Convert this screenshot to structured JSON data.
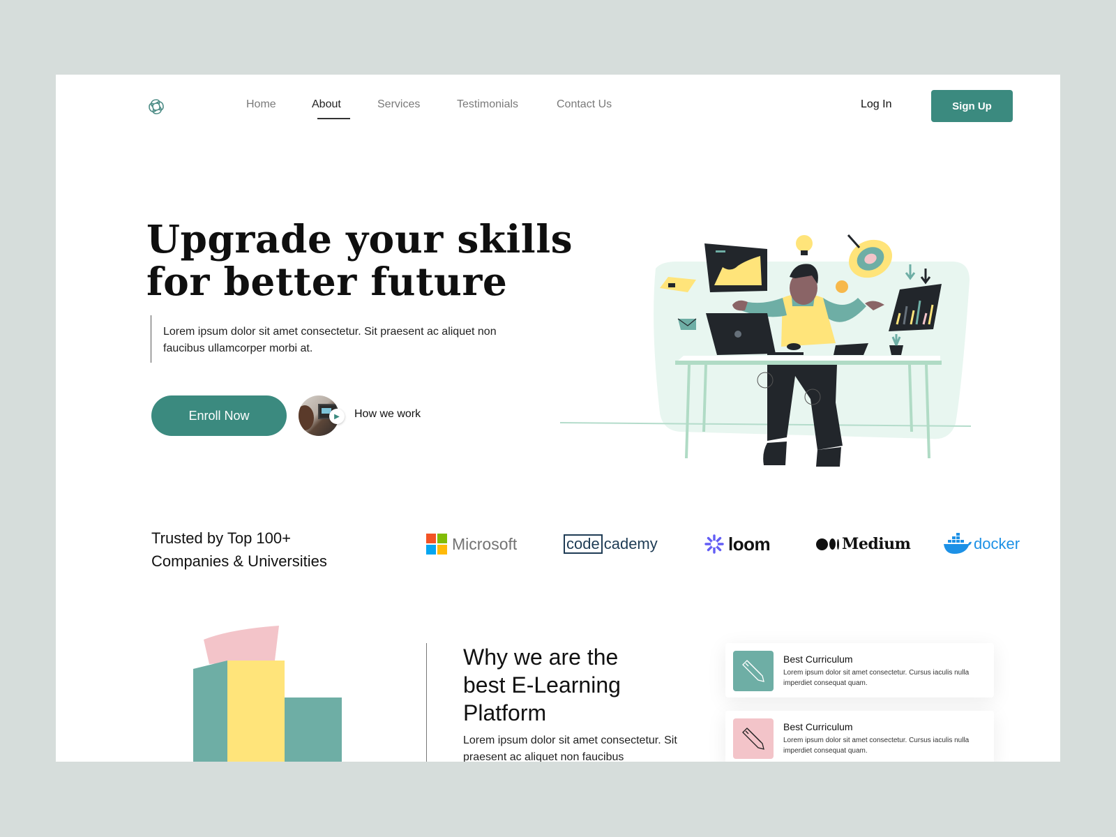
{
  "nav": {
    "logo_icon": "swirl-logo-icon",
    "items": [
      {
        "label": "Home",
        "active": false
      },
      {
        "label": "About",
        "active": true
      },
      {
        "label": "Services",
        "active": false
      },
      {
        "label": "Testimonials",
        "active": false
      },
      {
        "label": "Contact Us",
        "active": false
      }
    ],
    "login_label": "Log In",
    "signup_label": "Sign Up"
  },
  "hero": {
    "title_line1": "Upgrade your skills",
    "title_line2": "for better future",
    "description": "Lorem ipsum dolor sit amet consectetur. Sit praesent ac aliquet non faucibus ullamcorper morbi at.",
    "enroll_label": "Enroll Now",
    "video_label": "How we work",
    "play_icon": "play-icon",
    "illustration": "person-multitasking-at-desk-illustration"
  },
  "trusted": {
    "heading_line1": "Trusted by Top 100+",
    "heading_line2": "Companies & Universities",
    "logos": [
      {
        "name": "Microsoft",
        "text": "Microsoft"
      },
      {
        "name": "Codecademy",
        "text_box": "code",
        "text_rest": "cademy"
      },
      {
        "name": "Loom",
        "text": "loom"
      },
      {
        "name": "Medium",
        "text": "Medium"
      },
      {
        "name": "Docker",
        "text": "docker"
      }
    ]
  },
  "why": {
    "title_line1": "Why we are the",
    "title_line2": "best E-Learning",
    "title_line3": "Platform",
    "description": "Lorem ipsum dolor sit amet consectetur. Sit praesent ac aliquet non faucibus",
    "features": [
      {
        "title": "Best Curriculum",
        "description": "Lorem ipsum dolor sit amet consectetur. Cursus iaculis nulla imperdiet consequat quam.",
        "icon": "pencil-icon",
        "color": "#6eaea5"
      },
      {
        "title": "Best Curriculum",
        "description": "Lorem ipsum dolor sit amet consectetur. Cursus iaculis nulla imperdiet consequat quam.",
        "icon": "pencil-icon",
        "color": "#f3c4c9"
      }
    ]
  },
  "colors": {
    "primary": "#3b8a7f",
    "teal_light": "#6eaea5",
    "yellow": "#ffe47a",
    "pink": "#f3c4c9",
    "page_bg": "#d6dddb"
  }
}
